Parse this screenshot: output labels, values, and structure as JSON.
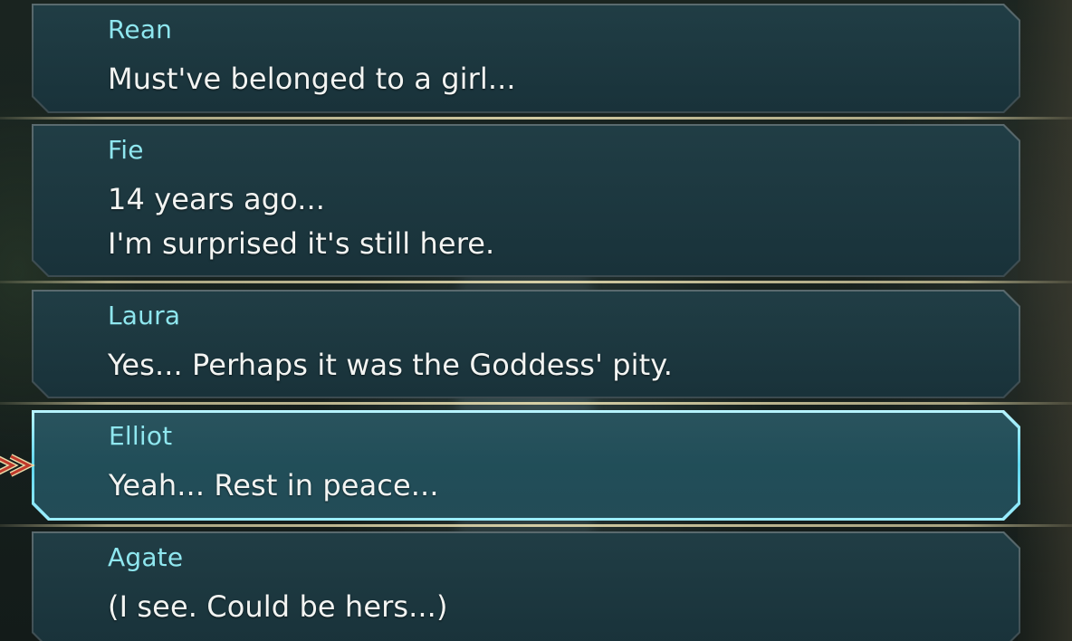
{
  "backlog": {
    "entries": [
      {
        "speaker": "Rean",
        "lines": [
          "Must've belonged to a girl..."
        ],
        "selected": false
      },
      {
        "speaker": "Fie",
        "lines": [
          "14 years ago...",
          "I'm surprised it's still here."
        ],
        "selected": false
      },
      {
        "speaker": "Laura",
        "lines": [
          "Yes... Perhaps it was the Goddess' pity."
        ],
        "selected": false
      },
      {
        "speaker": "Elliot",
        "lines": [
          "Yeah... Rest in peace..."
        ],
        "selected": true
      },
      {
        "speaker": "Agate",
        "lines": [
          "(I see. Could be hers...)"
        ],
        "selected": false
      }
    ],
    "cursor_icon": "double-chevron-right-icon",
    "colors": {
      "speaker_name": "#8fe7ef",
      "dialogue_text": "#f2f4f2",
      "selected_border": "#5fd6ec",
      "divider": "#e6dcaf",
      "cursor": "#c0392b"
    }
  }
}
